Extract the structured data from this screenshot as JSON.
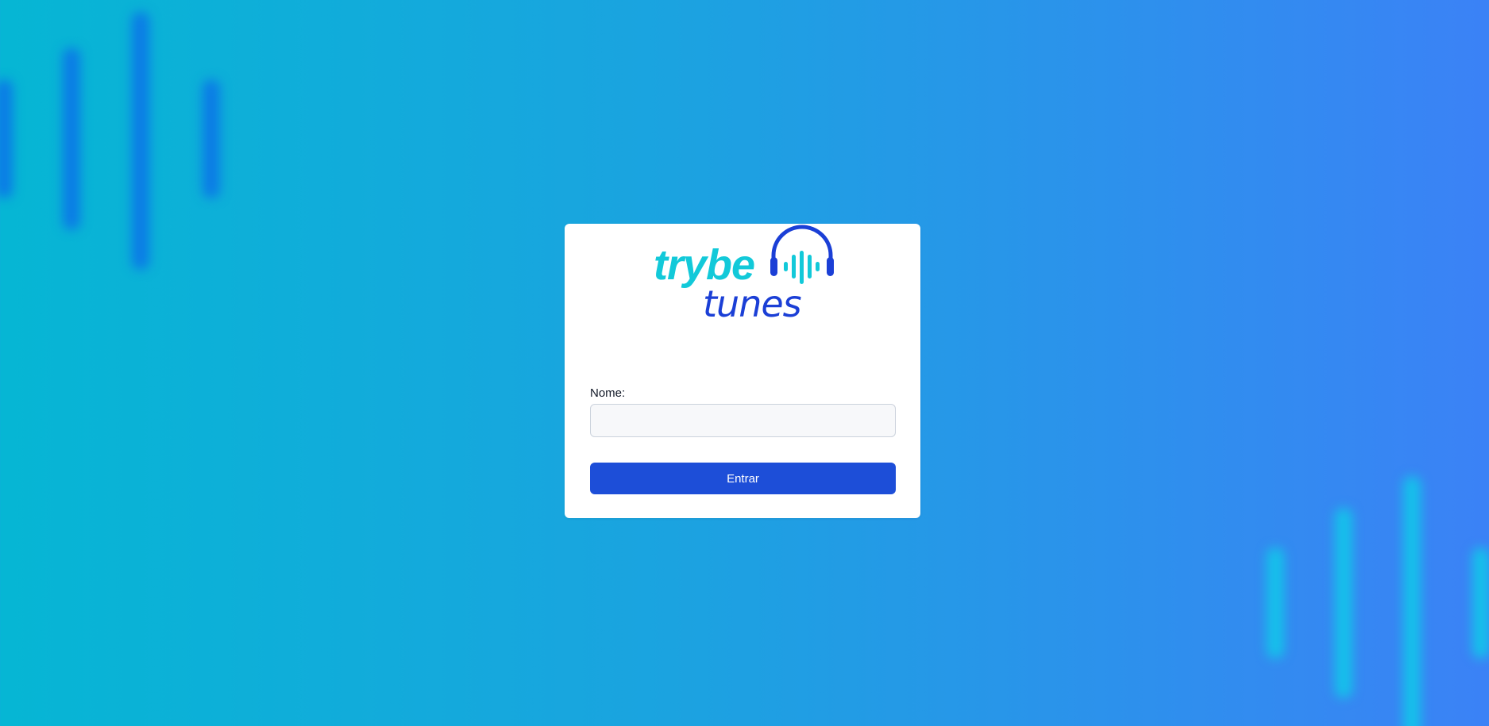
{
  "logo": {
    "line1": "trybe",
    "line2": "tunes",
    "icon": "headphones-soundwave-icon"
  },
  "form": {
    "name_label": "Nome:",
    "name_value": "",
    "name_placeholder": "",
    "submit_label": "Entrar"
  },
  "colors": {
    "background_start": "#06b6d4",
    "background_end": "#3b82f6",
    "logo_cyan": "#12c9d9",
    "logo_blue": "#1b3fd6",
    "button": "#1d4ed8",
    "card": "#ffffff"
  }
}
